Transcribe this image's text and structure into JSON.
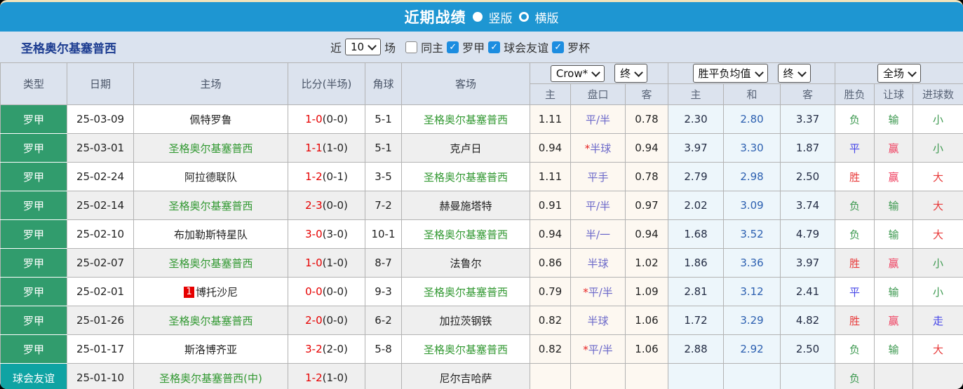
{
  "titlebar": {
    "title": "近期战绩",
    "radio_vertical_label": "竖版",
    "radio_horizontal_label": "横版",
    "selected_layout": "横版"
  },
  "filterbar": {
    "team": "圣格奥尔基塞普西",
    "near_label": "近",
    "count_value": "10",
    "matches_label": "场",
    "same_home_label": "同主",
    "same_home_checked": false,
    "leagues": [
      "罗甲",
      "球会友谊",
      "罗杯"
    ],
    "leagues_checked": [
      true,
      true,
      true
    ],
    "check_glyph": "✓"
  },
  "table": {
    "headers": {
      "type": "类型",
      "date": "日期",
      "home": "主场",
      "score": "比分(半场)",
      "corner": "角球",
      "away": "客场",
      "crow_select": "Crow*",
      "final_select1": "终",
      "avg_select": "胜平负均值",
      "final_select2": "终",
      "full_select": "全场",
      "sub": [
        "主",
        "盘口",
        "客",
        "主",
        "和",
        "客",
        "胜负",
        "让球",
        "进球数"
      ]
    },
    "rows": [
      {
        "type": "罗甲",
        "type_color": "green",
        "date": "25-03-09",
        "rank": "",
        "home": "佩特罗鲁",
        "home_green": false,
        "score_ft": "1-0",
        "score_ht": "(0-0)",
        "corner": "5-1",
        "away": "圣格奥尔基塞普西",
        "away_green": true,
        "odds_home": "1.11",
        "star": "",
        "handicap": "平/半",
        "odds_away": "0.78",
        "avg_win": "2.30",
        "avg_draw": "2.80",
        "avg_lose": "3.37",
        "result": "负",
        "result_c": "green",
        "hresult": "输",
        "hresult_c": "green",
        "goals": "小",
        "goals_c": "green"
      },
      {
        "type": "罗甲",
        "type_color": "green",
        "date": "25-03-01",
        "rank": "",
        "home": "圣格奥尔基塞普西",
        "home_green": true,
        "score_ft": "1-1",
        "score_ht": "(1-0)",
        "corner": "5-1",
        "away": "克卢日",
        "away_green": false,
        "odds_home": "0.94",
        "star": "*",
        "handicap": "半球",
        "odds_away": "0.94",
        "avg_win": "3.97",
        "avg_draw": "3.30",
        "avg_lose": "1.87",
        "result": "平",
        "result_c": "blue",
        "hresult": "赢",
        "hresult_c": "pink",
        "goals": "小",
        "goals_c": "green"
      },
      {
        "type": "罗甲",
        "type_color": "green",
        "date": "25-02-24",
        "rank": "",
        "home": "阿拉德联队",
        "home_green": false,
        "score_ft": "1-2",
        "score_ht": "(0-1)",
        "corner": "3-5",
        "away": "圣格奥尔基塞普西",
        "away_green": true,
        "odds_home": "1.11",
        "star": "",
        "handicap": "平手",
        "odds_away": "0.78",
        "avg_win": "2.79",
        "avg_draw": "2.98",
        "avg_lose": "2.50",
        "result": "胜",
        "result_c": "red",
        "hresult": "赢",
        "hresult_c": "pink",
        "goals": "大",
        "goals_c": "red"
      },
      {
        "type": "罗甲",
        "type_color": "green",
        "date": "25-02-14",
        "rank": "",
        "home": "圣格奥尔基塞普西",
        "home_green": true,
        "score_ft": "2-3",
        "score_ht": "(0-0)",
        "corner": "7-2",
        "away": "赫曼施塔特",
        "away_green": false,
        "odds_home": "0.91",
        "star": "",
        "handicap": "平/半",
        "odds_away": "0.97",
        "avg_win": "2.02",
        "avg_draw": "3.09",
        "avg_lose": "3.74",
        "result": "负",
        "result_c": "green",
        "hresult": "输",
        "hresult_c": "green",
        "goals": "大",
        "goals_c": "red"
      },
      {
        "type": "罗甲",
        "type_color": "green",
        "date": "25-02-10",
        "rank": "",
        "home": "布加勒斯特星队",
        "home_green": false,
        "score_ft": "3-0",
        "score_ht": "(3-0)",
        "corner": "10-1",
        "away": "圣格奥尔基塞普西",
        "away_green": true,
        "odds_home": "0.94",
        "star": "",
        "handicap": "半/一",
        "odds_away": "0.94",
        "avg_win": "1.68",
        "avg_draw": "3.52",
        "avg_lose": "4.79",
        "result": "负",
        "result_c": "green",
        "hresult": "输",
        "hresult_c": "green",
        "goals": "大",
        "goals_c": "red"
      },
      {
        "type": "罗甲",
        "type_color": "green",
        "date": "25-02-07",
        "rank": "",
        "home": "圣格奥尔基塞普西",
        "home_green": true,
        "score_ft": "1-0",
        "score_ht": "(1-0)",
        "corner": "8-7",
        "away": "法鲁尔",
        "away_green": false,
        "odds_home": "0.86",
        "star": "",
        "handicap": "半球",
        "odds_away": "1.02",
        "avg_win": "1.86",
        "avg_draw": "3.36",
        "avg_lose": "3.97",
        "result": "胜",
        "result_c": "red",
        "hresult": "赢",
        "hresult_c": "pink",
        "goals": "小",
        "goals_c": "green"
      },
      {
        "type": "罗甲",
        "type_color": "green",
        "date": "25-02-01",
        "rank": "1",
        "home": "博托沙尼",
        "home_green": false,
        "score_ft": "0-0",
        "score_ht": "(0-0)",
        "corner": "9-3",
        "away": "圣格奥尔基塞普西",
        "away_green": true,
        "odds_home": "0.79",
        "star": "*",
        "handicap": "平/半",
        "odds_away": "1.09",
        "avg_win": "2.81",
        "avg_draw": "3.12",
        "avg_lose": "2.41",
        "result": "平",
        "result_c": "blue",
        "hresult": "输",
        "hresult_c": "green",
        "goals": "小",
        "goals_c": "green"
      },
      {
        "type": "罗甲",
        "type_color": "green",
        "date": "25-01-26",
        "rank": "",
        "home": "圣格奥尔基塞普西",
        "home_green": true,
        "score_ft": "2-0",
        "score_ht": "(0-0)",
        "corner": "6-2",
        "away": "加拉茨钢铁",
        "away_green": false,
        "odds_home": "0.82",
        "star": "",
        "handicap": "半球",
        "odds_away": "1.06",
        "avg_win": "1.72",
        "avg_draw": "3.29",
        "avg_lose": "4.82",
        "result": "胜",
        "result_c": "red",
        "hresult": "赢",
        "hresult_c": "pink",
        "goals": "走",
        "goals_c": "blue"
      },
      {
        "type": "罗甲",
        "type_color": "green",
        "date": "25-01-17",
        "rank": "",
        "home": "斯洛博齐亚",
        "home_green": false,
        "score_ft": "3-2",
        "score_ht": "(2-0)",
        "corner": "5-8",
        "away": "圣格奥尔基塞普西",
        "away_green": true,
        "odds_home": "0.82",
        "star": "*",
        "handicap": "平/半",
        "odds_away": "1.06",
        "avg_win": "2.88",
        "avg_draw": "2.92",
        "avg_lose": "2.50",
        "result": "负",
        "result_c": "green",
        "hresult": "输",
        "hresult_c": "green",
        "goals": "大",
        "goals_c": "red"
      },
      {
        "type": "球会友谊",
        "type_color": "teal",
        "date": "25-01-10",
        "rank": "",
        "home": "圣格奥尔基塞普西(中)",
        "home_green": true,
        "score_ft": "1-2",
        "score_ht": "(1-0)",
        "corner": "",
        "away": "尼尔吉哈萨",
        "away_green": false,
        "odds_home": "",
        "star": "",
        "handicap": "",
        "odds_away": "",
        "avg_win": "",
        "avg_draw": "",
        "avg_lose": "",
        "result": "负",
        "result_c": "green",
        "hresult": "",
        "hresult_c": "",
        "goals": "",
        "goals_c": ""
      }
    ]
  },
  "colors": {
    "topbar_blue": "#1E96D2",
    "panel_bg": "#dbe3ef",
    "badge_green": "#319C6D",
    "badge_teal": "#0FA3A3",
    "team_green": "#339933",
    "score_red": "#e60000",
    "handicap_purple": "#6B68C9",
    "avg_draw_blue": "#2B5FB0",
    "win_red": "#E83A3A",
    "draw_blue": "#4545E8",
    "lose_green": "#3D9950",
    "win_pink": "#EF4060"
  }
}
